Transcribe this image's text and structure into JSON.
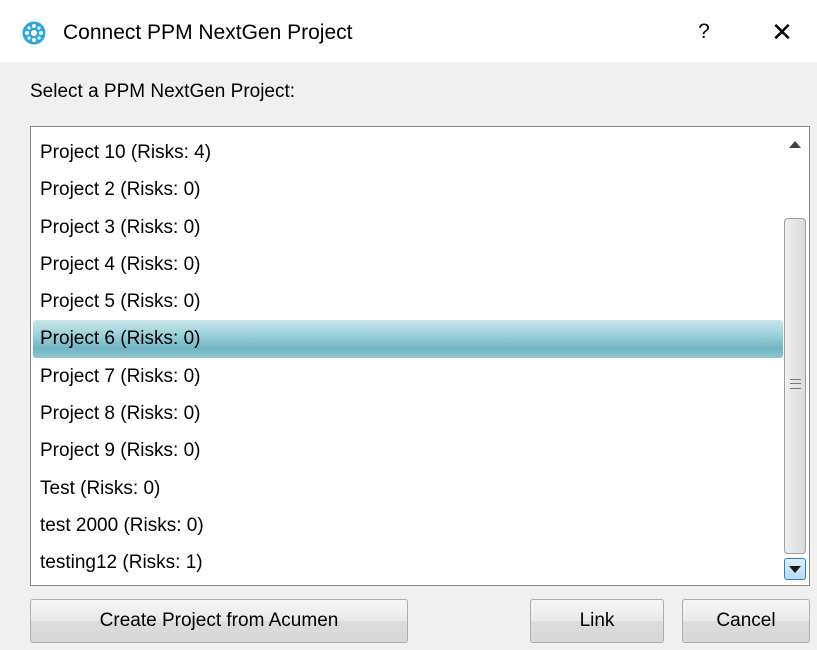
{
  "window": {
    "title": "Connect PPM NextGen Project",
    "help_label": "?",
    "close_label": "✕",
    "icon": "app-logo-icon",
    "accent_color": "#2aa7dd"
  },
  "prompt": "Select a PPM NextGen Project:",
  "projects": {
    "items": [
      "Project 10 (Risks: 4)",
      "Project 2 (Risks: 0)",
      "Project 3 (Risks: 0)",
      "Project 4 (Risks: 0)",
      "Project 5 (Risks: 0)",
      "Project 6 (Risks: 0)",
      "Project 7 (Risks: 0)",
      "Project 8 (Risks: 0)",
      "Project 9 (Risks: 0)",
      "Test (Risks: 0)",
      "test 2000 (Risks: 0)",
      "testing12 (Risks: 1)"
    ],
    "selected_index": 5,
    "selection_color": "#8cc8d4"
  },
  "buttons": {
    "create_label": "Create Project from Acumen",
    "link_label": "Link",
    "cancel_label": "Cancel"
  }
}
